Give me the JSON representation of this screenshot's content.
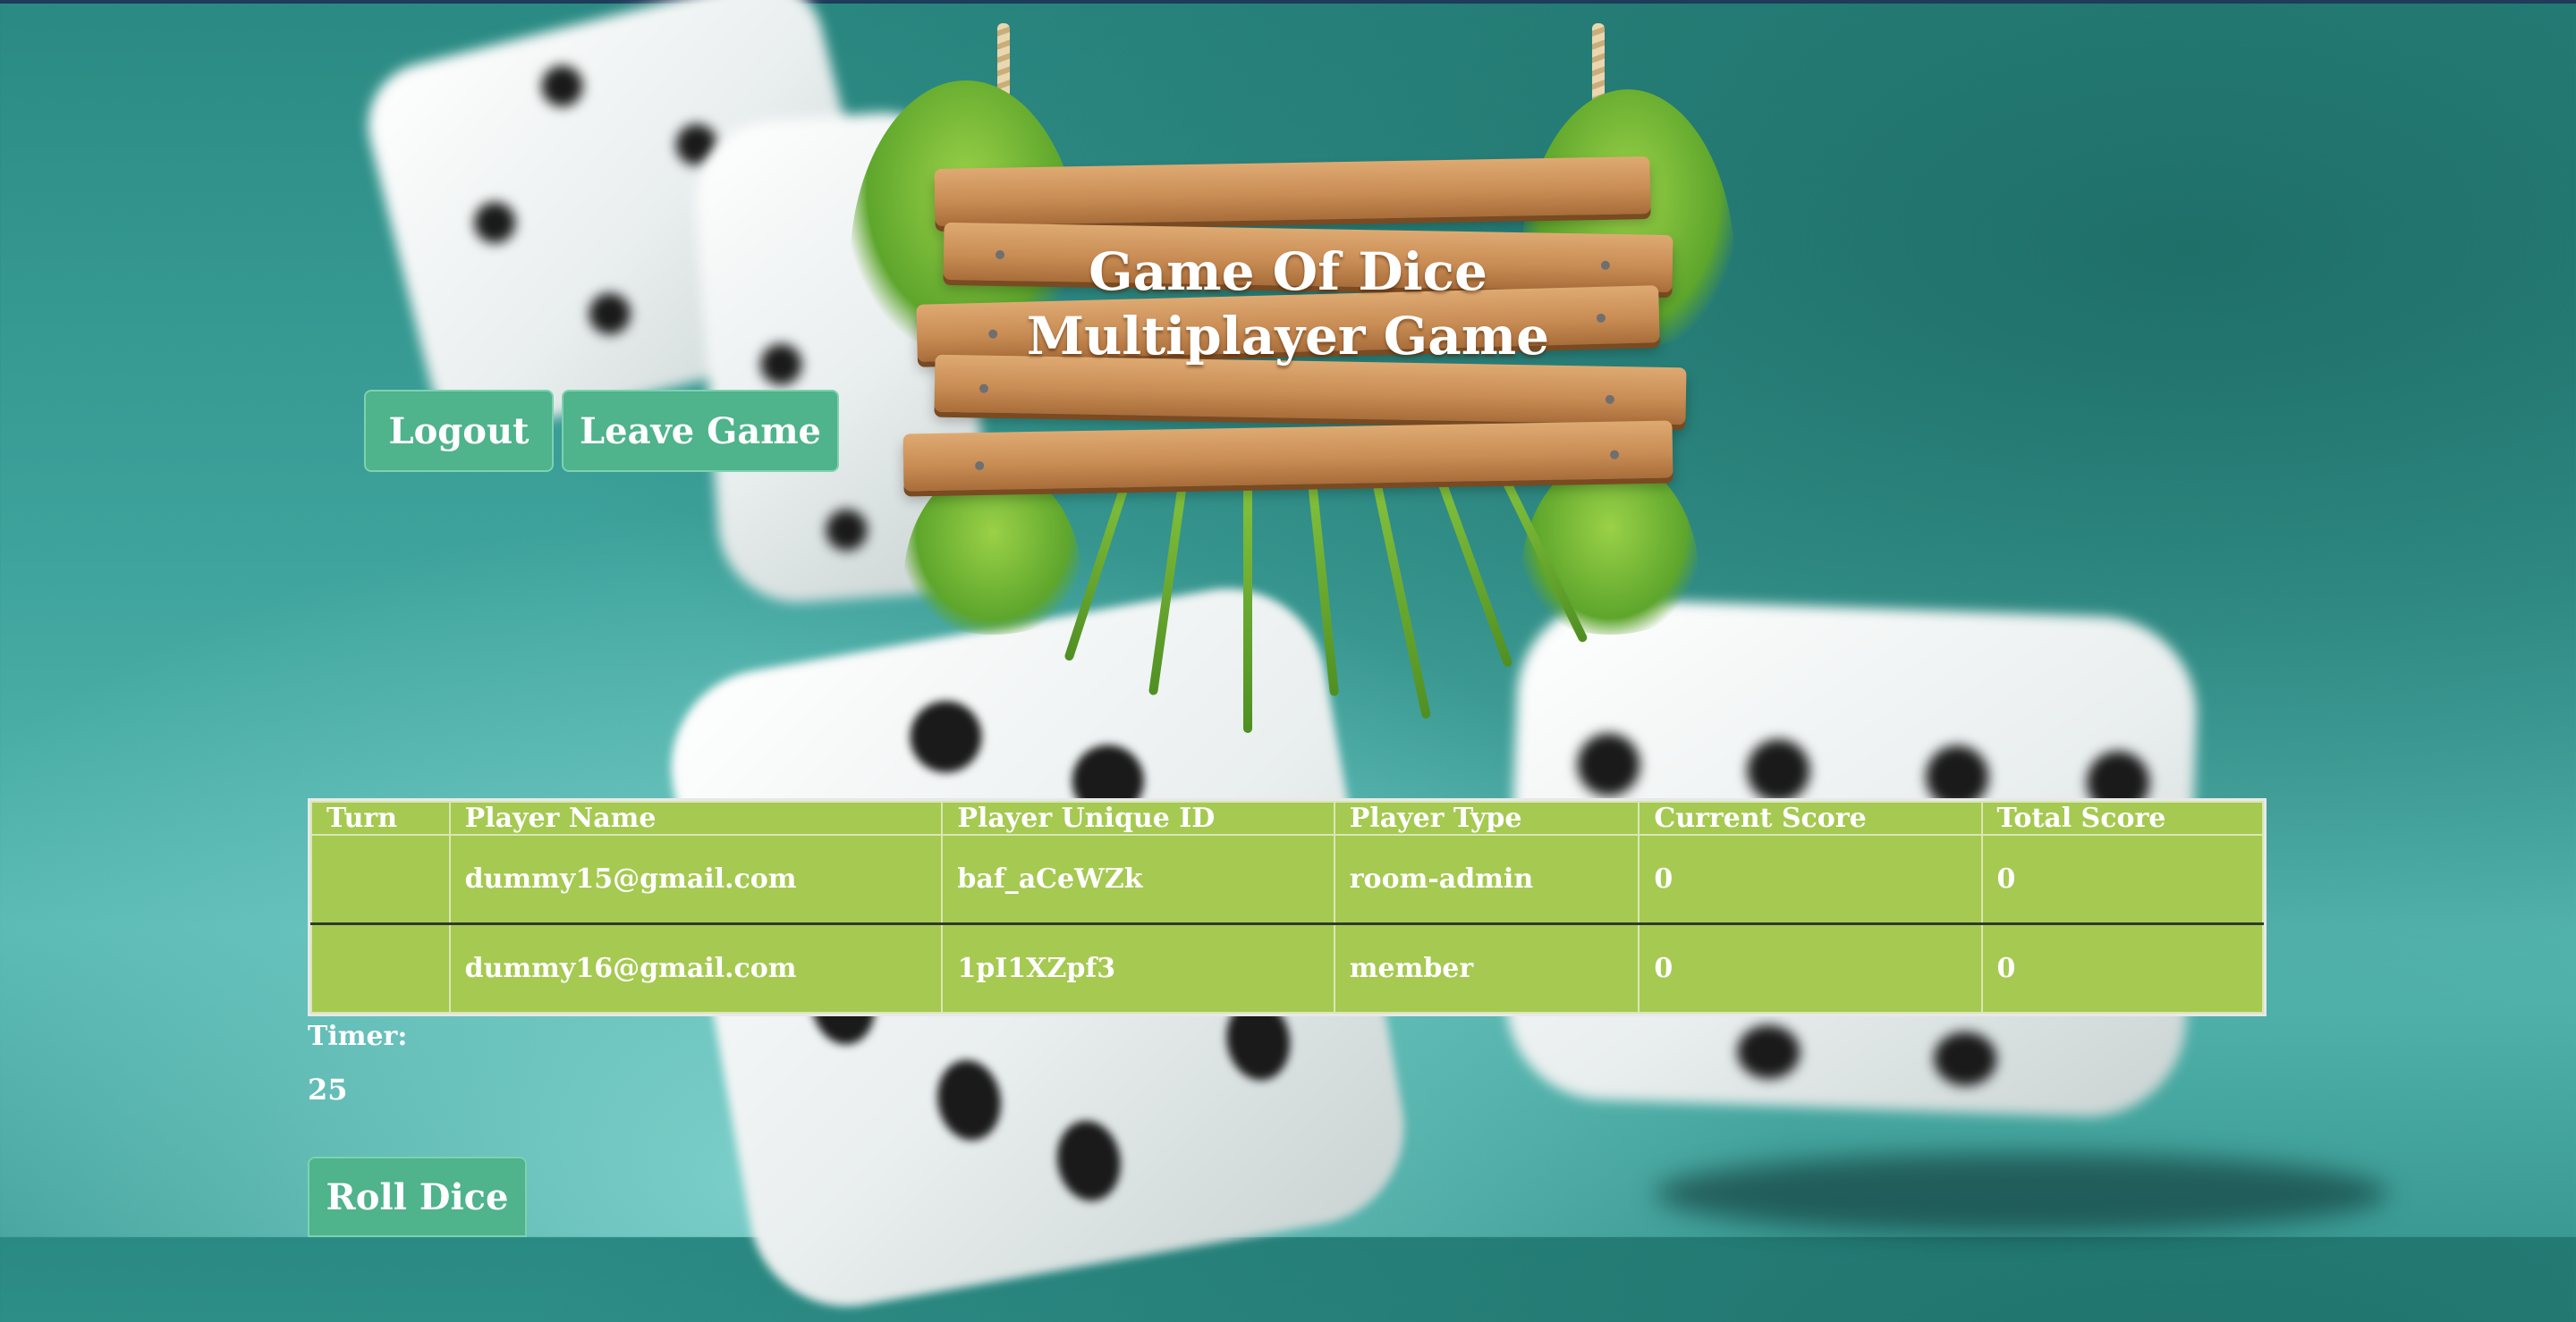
{
  "sign": {
    "title_line1": "Game Of Dice",
    "title_line2": "Multiplayer Game"
  },
  "buttons": {
    "logout": "Logout",
    "leave_game": "Leave Game",
    "roll_dice": "Roll Dice"
  },
  "table": {
    "headers": [
      "Turn",
      "Player Name",
      "Player Unique ID",
      "Player Type",
      "Current Score",
      "Total Score"
    ],
    "rows": [
      [
        "",
        "dummy15@gmail.com",
        "baf_aCeWZk",
        "room-admin",
        "0",
        "0"
      ],
      [
        "",
        "dummy16@gmail.com",
        "1pI1XZpf3",
        "member",
        "0",
        "0"
      ]
    ]
  },
  "timer": {
    "label": "Timer:",
    "value": "25"
  },
  "colors": {
    "button": "#4fb38c",
    "table_bg": "#a6c952",
    "background": "#3ea39c"
  }
}
